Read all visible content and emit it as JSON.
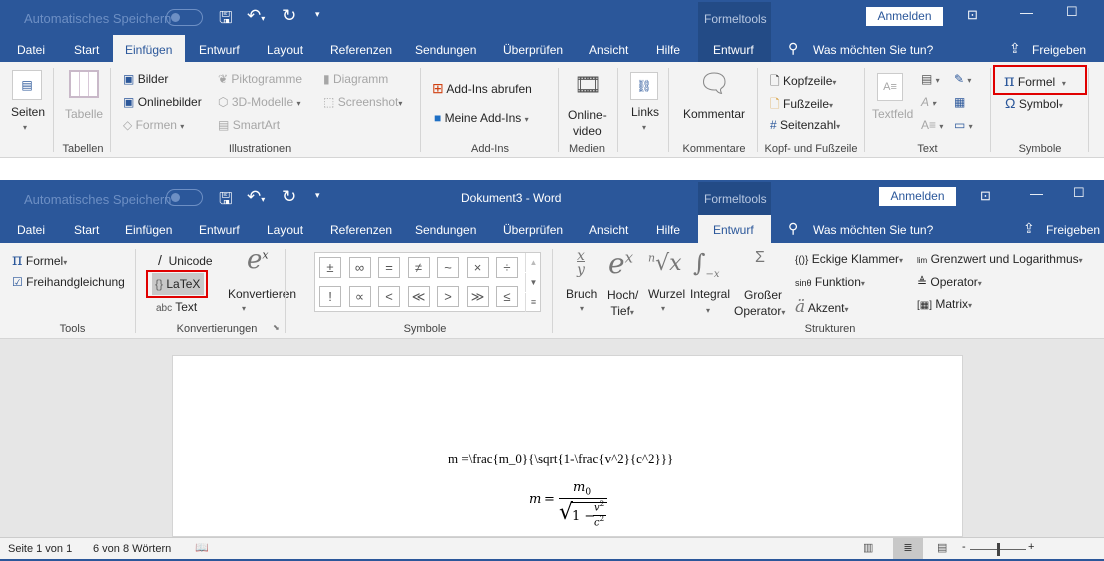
{
  "colors": {
    "brand": "#2b579a",
    "ribbon": "#f3f3f3",
    "highlight": "#e00000"
  },
  "window1": {
    "autosave": "Automatisches Speichern",
    "context_group": "Formeltools",
    "sign_in": "Anmelden",
    "tabs": [
      "Datei",
      "Start",
      "Einfügen",
      "Entwurf",
      "Layout",
      "Referenzen",
      "Sendungen",
      "Überprüfen",
      "Ansicht",
      "Hilfe",
      "Entwurf"
    ],
    "active_tab": "Einfügen",
    "tell_me": "Was möchten Sie tun?",
    "share": "Freigeben",
    "ribbon": {
      "seiten": "Seiten",
      "tabelle": "Tabelle",
      "g_tabellen": "Tabellen",
      "bilder": "Bilder",
      "onlinebilder": "Onlinebilder",
      "formen": "Formen",
      "piktogramme": "Piktogramme",
      "modelle3d": "3D-Modelle",
      "smartart": "SmartArt",
      "diagramm": "Diagramm",
      "screenshot": "Screenshot",
      "g_illustrationen": "Illustrationen",
      "addins_abrufen": "Add-Ins abrufen",
      "meine_addins": "Meine Add-Ins",
      "g_addins": "Add-Ins",
      "onlinevideo1": "Online-",
      "onlinevideo2": "video",
      "g_medien": "Medien",
      "links": "Links",
      "kommentar": "Kommentar",
      "g_kommentare": "Kommentare",
      "kopfzeile": "Kopfzeile",
      "fusszeile": "Fußzeile",
      "seitenzahl": "Seitenzahl",
      "g_kopf": "Kopf- und Fußzeile",
      "textfeld": "Textfeld",
      "g_text": "Text",
      "formel": "Formel",
      "symbol": "Symbol",
      "g_symbole": "Symbole"
    }
  },
  "window2": {
    "autosave": "Automatisches Speichern",
    "title": "Dokument3  -  Word",
    "context_group": "Formeltools",
    "sign_in": "Anmelden",
    "tabs": [
      "Datei",
      "Start",
      "Einfügen",
      "Entwurf",
      "Layout",
      "Referenzen",
      "Sendungen",
      "Überprüfen",
      "Ansicht",
      "Hilfe",
      "Entwurf"
    ],
    "active_tab": "Entwurf",
    "tell_me": "Was möchten Sie tun?",
    "share": "Freigeben",
    "ribbon": {
      "formel": "Formel",
      "freihand": "Freihandgleichung",
      "g_tools": "Tools",
      "unicode": "Unicode",
      "latex": "LaTeX",
      "text": "Text",
      "text_prefix": "abc",
      "konvertieren": "Konvertieren",
      "g_konv": "Konvertierungen",
      "symbols": [
        "±",
        "∞",
        "=",
        "≠",
        "~",
        "×",
        "÷",
        "!",
        "∝",
        "<",
        "≪",
        ">",
        "≫",
        "≤"
      ],
      "g_symbole": "Symbole",
      "bruch": "Bruch",
      "hoch1": "Hoch/",
      "hoch2": "Tief",
      "wurzel": "Wurzel",
      "integral": "Integral",
      "gross1": "Großer",
      "gross2": "Operator",
      "klammer": "Eckige Klammer",
      "funktion": "Funktion",
      "akzent": "Akzent",
      "grenzwert": "Grenzwert und Logarithmus",
      "operator": "Operator",
      "matrix": "Matrix",
      "g_strukturen": "Strukturen"
    }
  },
  "document": {
    "latex_source": "m =\\frac{m_0}{\\sqrt{1-\\frac{v^2}{c^2}}}",
    "eq_m": "m",
    "eq_eq": "=",
    "eq_num": "m",
    "eq_num_sub": "0",
    "eq_one": "1 −",
    "eq_v": "v",
    "eq_c": "c",
    "eq_exp": "2"
  },
  "status": {
    "page": "Seite 1 von 1",
    "words": "6 von 8 Wörtern",
    "view": "print-layout",
    "zoom_percent": 100
  }
}
